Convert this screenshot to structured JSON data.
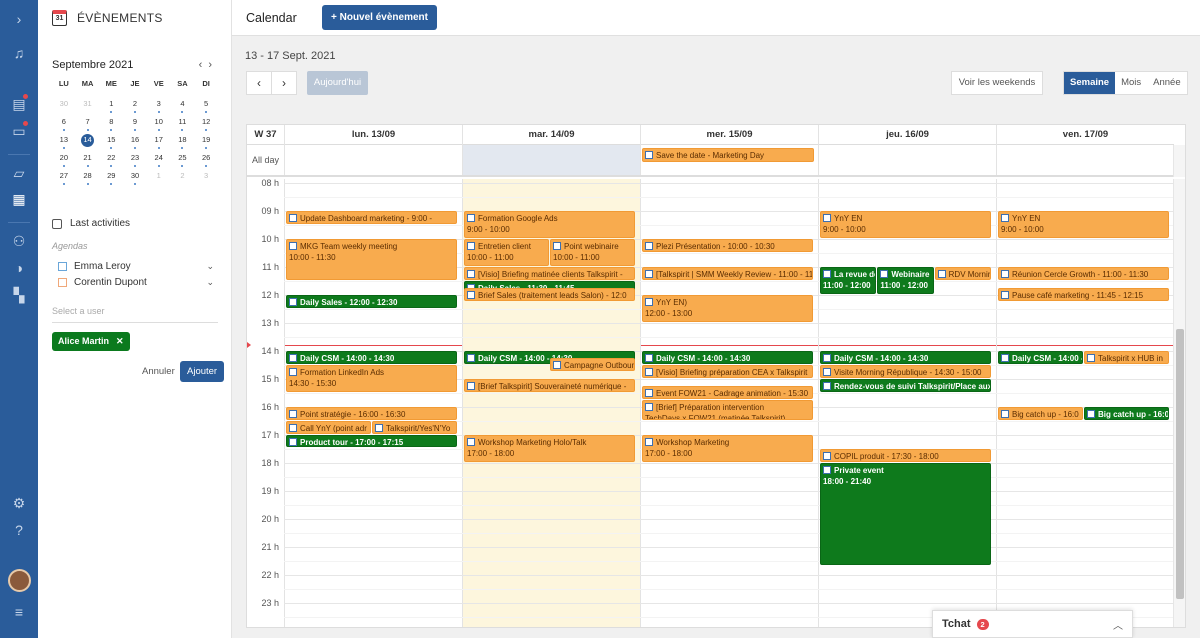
{
  "rail": {
    "icons": [
      "menu-expand-icon",
      "bell-icon",
      "news-icon",
      "chat-icon",
      "folder-icon",
      "calendar-icon",
      "users-icon",
      "toggle-icon",
      "apps-icon",
      "settings-icon",
      "help-icon",
      "sliders-icon"
    ]
  },
  "sidebar": {
    "title": "ÉVÈNEMENTS",
    "cal_icon_num": "31",
    "month": "Septembre 2021",
    "prev": "‹",
    "next": "›",
    "weekdays": [
      "LU",
      "MA",
      "ME",
      "JE",
      "VE",
      "SA",
      "DI"
    ],
    "days": [
      "30",
      "31",
      "1",
      "2",
      "3",
      "4",
      "5",
      "6",
      "7",
      "8",
      "9",
      "10",
      "11",
      "12",
      "13",
      "14",
      "15",
      "16",
      "17",
      "18",
      "19",
      "20",
      "21",
      "22",
      "23",
      "24",
      "25",
      "26",
      "27",
      "28",
      "29",
      "30",
      "1",
      "2",
      "3"
    ],
    "last_activities": "Last activities",
    "agendas_label": "Agendas",
    "agendas": [
      "Emma Leroy",
      "Corentin Dupont"
    ],
    "select_user_placeholder": "Select a user",
    "chip": "Alice Martin",
    "chip_x": "✕",
    "cancel": "Annuler",
    "add": "Ajouter"
  },
  "toolbar": {
    "title": "Calendar",
    "new_event": "+ Nouvel évènement"
  },
  "controls": {
    "range": "13 - 17 Sept. 2021",
    "prev": "‹",
    "next": "›",
    "today": "Aujourd'hui",
    "weekends": "Voir les weekends",
    "views": [
      "Semaine",
      "Mois",
      "Année"
    ],
    "active_view": "Semaine"
  },
  "calendar": {
    "week_label": "W 37",
    "all_day_label": "All day",
    "days": [
      "lun. 13/09",
      "mar. 14/09",
      "mer. 15/09",
      "jeu. 16/09",
      "ven. 17/09"
    ],
    "hours": [
      "08 h",
      "09 h",
      "10 h",
      "11 h",
      "12 h",
      "13 h",
      "14 h",
      "15 h",
      "16 h",
      "17 h",
      "18 h",
      "19 h",
      "20 h",
      "21 h",
      "22 h",
      "23 h"
    ],
    "all_day_events": [
      {
        "day": 2,
        "title": "Save the date - Marketing Day"
      }
    ],
    "events": [
      {
        "day": 0,
        "start": 9.0,
        "end": 9.5,
        "c": "o",
        "t": "Update Dashboard marketing - 9:00 -",
        "col": 0,
        "cols": 1
      },
      {
        "day": 0,
        "start": 10.0,
        "end": 11.5,
        "c": "o",
        "t": "MKG Team weekly meeting",
        "t2": "10:00 - 11:30",
        "col": 0,
        "cols": 1
      },
      {
        "day": 0,
        "start": 12.0,
        "end": 12.5,
        "c": "g",
        "t": "Daily Sales - 12:00 - 12:30",
        "col": 0,
        "cols": 1
      },
      {
        "day": 0,
        "start": 14.0,
        "end": 14.5,
        "c": "g",
        "t": "Daily CSM  - 14:00 - 14:30",
        "col": 0,
        "cols": 1
      },
      {
        "day": 0,
        "start": 14.5,
        "end": 15.5,
        "c": "o",
        "t": "Formation LinkedIn Ads",
        "t2": "14:30 - 15:30",
        "col": 0,
        "cols": 1
      },
      {
        "day": 0,
        "start": 16.0,
        "end": 16.5,
        "c": "o",
        "t": "Point stratégie - 16:00 - 16:30",
        "col": 0,
        "cols": 1
      },
      {
        "day": 0,
        "start": 16.5,
        "end": 17.0,
        "c": "o",
        "t": "Call YnY (point adr",
        "col": 0,
        "cols": 2
      },
      {
        "day": 0,
        "start": 16.5,
        "end": 17.0,
        "c": "o",
        "t": "Talkspirit/Yes'N'Yo",
        "col": 1,
        "cols": 2
      },
      {
        "day": 0,
        "start": 17.0,
        "end": 17.25,
        "c": "g",
        "t": "Product tour - 17:00 - 17:15",
        "col": 0,
        "cols": 1
      },
      {
        "day": 1,
        "start": 9.0,
        "end": 10.0,
        "c": "o",
        "t": "Formation Google Ads",
        "t2": "9:00 - 10:00",
        "col": 0,
        "cols": 1
      },
      {
        "day": 1,
        "start": 10.0,
        "end": 11.0,
        "c": "o",
        "t": "Entretien client",
        "t2": "10:00 - 11:00",
        "col": 0,
        "cols": 2
      },
      {
        "day": 1,
        "start": 10.0,
        "end": 11.0,
        "c": "o",
        "t": "Point webinaire",
        "t2": "10:00 - 11:00",
        "col": 1,
        "cols": 2
      },
      {
        "day": 1,
        "start": 11.0,
        "end": 11.5,
        "c": "o",
        "t": "[Visio] Briefing matinée clients Talkspirit -",
        "col": 0,
        "cols": 1
      },
      {
        "day": 1,
        "start": 11.5,
        "end": 11.75,
        "c": "g",
        "t": "Daily Sales - 11:30 - 11:45",
        "col": 0,
        "cols": 1
      },
      {
        "day": 1,
        "start": 11.75,
        "end": 12.25,
        "c": "o",
        "t": "Brief Sales (traitement leads Salon) - 12:0",
        "col": 0,
        "cols": 1
      },
      {
        "day": 1,
        "start": 14.0,
        "end": 14.5,
        "c": "g",
        "t": "Daily CSM  - 14:00 - 14:30",
        "col": 0,
        "cols": 1
      },
      {
        "day": 1,
        "start": 14.25,
        "end": 14.75,
        "c": "o",
        "t": "Campagne Outbound",
        "col": 1,
        "cols": 2
      },
      {
        "day": 1,
        "start": 15.0,
        "end": 15.5,
        "c": "o",
        "t": "[Brief Talkspirit] Souveraineté numérique -",
        "col": 0,
        "cols": 1
      },
      {
        "day": 1,
        "start": 17.0,
        "end": 18.0,
        "c": "o",
        "t": "Workshop Marketing Holo/Talk",
        "t2": "17:00 - 18:00",
        "col": 0,
        "cols": 1
      },
      {
        "day": 2,
        "start": 10.0,
        "end": 10.5,
        "c": "o",
        "t": "Plezi Présentation  - 10:00 - 10:30",
        "col": 0,
        "cols": 1
      },
      {
        "day": 2,
        "start": 11.0,
        "end": 11.5,
        "c": "o",
        "t": "[Talkspirit | SMM Weekly Review - 11:00 - 11",
        "col": 0,
        "cols": 1
      },
      {
        "day": 2,
        "start": 12.0,
        "end": 13.0,
        "c": "o",
        "t": "YnY EN)",
        "t2": "12:00 - 13:00",
        "col": 0,
        "cols": 1
      },
      {
        "day": 2,
        "start": 14.0,
        "end": 14.5,
        "c": "g",
        "t": "Daily CSM  - 14:00 - 14:30",
        "col": 0,
        "cols": 1
      },
      {
        "day": 2,
        "start": 14.5,
        "end": 15.0,
        "c": "o",
        "t": "[Visio] Briefing préparation CEA x Talkspirit",
        "col": 0,
        "cols": 1
      },
      {
        "day": 2,
        "start": 15.25,
        "end": 15.75,
        "c": "o",
        "t": "Event FOW21 - Cadrage animation - 15:30",
        "col": 0,
        "cols": 1
      },
      {
        "day": 2,
        "start": 15.75,
        "end": 16.5,
        "c": "o",
        "t": "[Brief] Préparation intervention",
        "t2": "TechDays x FOW21 (matinée Talkspirit)",
        "col": 0,
        "cols": 1
      },
      {
        "day": 2,
        "start": 17.0,
        "end": 18.0,
        "c": "o",
        "t": "Workshop Marketing",
        "t2": "17:00 - 18:00",
        "col": 0,
        "cols": 1
      },
      {
        "day": 3,
        "start": 9.0,
        "end": 10.0,
        "c": "o",
        "t": "YnY EN",
        "t2": "9:00 - 10:00",
        "col": 0,
        "cols": 1
      },
      {
        "day": 3,
        "start": 11.0,
        "end": 12.0,
        "c": "g",
        "t": "La revue de",
        "t2": "11:00 - 12:00",
        "col": 0,
        "cols": 3
      },
      {
        "day": 3,
        "start": 11.0,
        "end": 12.0,
        "c": "g",
        "t": "Webinaire",
        "t2": "11:00 - 12:00",
        "col": 1,
        "cols": 3
      },
      {
        "day": 3,
        "start": 11.0,
        "end": 11.5,
        "c": "o",
        "t": "RDV Morning",
        "col": 2,
        "cols": 3
      },
      {
        "day": 3,
        "start": 14.0,
        "end": 14.5,
        "c": "g",
        "t": "Daily CSM  - 14:00 - 14:30",
        "col": 0,
        "cols": 1
      },
      {
        "day": 3,
        "start": 14.5,
        "end": 15.0,
        "c": "o",
        "t": "Visite Morning République - 14:30 - 15:00",
        "col": 0,
        "cols": 1
      },
      {
        "day": 3,
        "start": 15.0,
        "end": 15.5,
        "c": "g",
        "t": "Rendez-vous de suivi Talkspirit/Place aux",
        "col": 0,
        "cols": 1
      },
      {
        "day": 3,
        "start": 17.5,
        "end": 18.0,
        "c": "o",
        "t": "COPIL produit - 17:30 - 18:00",
        "col": 0,
        "cols": 1
      },
      {
        "day": 3,
        "start": 18.0,
        "end": 21.67,
        "c": "g",
        "t": "Private event",
        "t2": "18:00 - 21:40",
        "col": 0,
        "cols": 1
      },
      {
        "day": 4,
        "start": 9.0,
        "end": 10.0,
        "c": "o",
        "t": "YnY EN",
        "t2": "9:00 - 10:00",
        "col": 0,
        "cols": 1
      },
      {
        "day": 4,
        "start": 11.0,
        "end": 11.5,
        "c": "o",
        "t": "Réunion Cercle Growth  - 11:00 - 11:30",
        "col": 0,
        "cols": 1
      },
      {
        "day": 4,
        "start": 11.75,
        "end": 12.25,
        "c": "o",
        "t": "Pause café marketing  - 11:45 - 12:15",
        "col": 0,
        "cols": 1
      },
      {
        "day": 4,
        "start": 14.0,
        "end": 14.5,
        "c": "g",
        "t": "Daily CSM  - 14:00 - 14:30",
        "col": 0,
        "cols": 2
      },
      {
        "day": 4,
        "start": 14.0,
        "end": 14.5,
        "c": "o",
        "t": "Talkspirit x HUB in",
        "col": 1,
        "cols": 2
      },
      {
        "day": 4,
        "start": 16.0,
        "end": 16.5,
        "c": "o",
        "t": "Big catch up  - 16:0",
        "col": 0,
        "cols": 2
      },
      {
        "day": 4,
        "start": 16.0,
        "end": 16.5,
        "c": "g",
        "t": "Big catch up - 16:0",
        "col": 1,
        "cols": 2
      }
    ]
  },
  "chat": {
    "label": "Tchat",
    "count": "2",
    "toggle": "︿"
  },
  "colors": {
    "brand": "#2a5c9a",
    "orange": "#f8ab4e",
    "green": "#0e7a1c",
    "today_col": "#fdf6dd",
    "allday_today": "#e3e8f0"
  }
}
